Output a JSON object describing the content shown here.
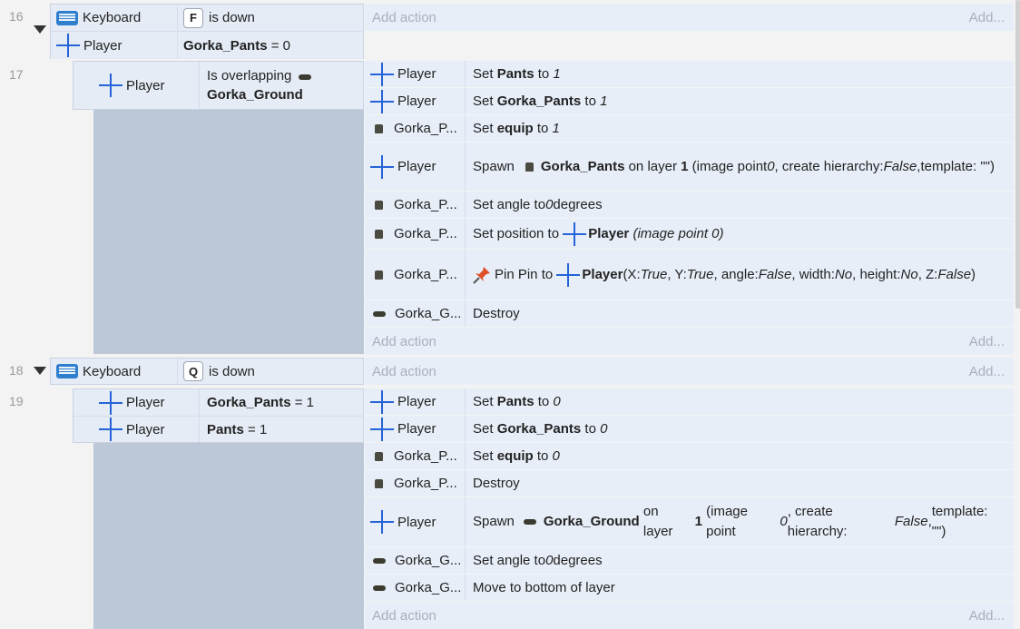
{
  "events": {
    "e16": {
      "num": "16",
      "cond1": {
        "obj": "Keyboard",
        "key": "F",
        "text": "is down"
      },
      "cond2": {
        "obj": "Player",
        "var": "Gorka_Pants",
        "op": "= 0"
      },
      "add_action": "Add action",
      "add": "Add..."
    },
    "e17": {
      "num": "17",
      "cond": {
        "obj": "Player",
        "text": "Is overlapping",
        "target": "Gorka_Ground"
      },
      "actions": [
        {
          "obj": "Player",
          "pre": "Set ",
          "b": "Pants",
          "post": " to ",
          "val": "1"
        },
        {
          "obj": "Player",
          "pre": "Set ",
          "b": "Gorka_Pants",
          "post": " to ",
          "val": "1"
        },
        {
          "obj": "Gorka_P...",
          "pre": "Set ",
          "b": "equip",
          "post": " to ",
          "val": "1"
        },
        {
          "obj": "Player",
          "spawn_pre": "Spawn",
          "spawn_obj": "Gorka_Pants",
          "spawn_mid": "on layer",
          "layer": "1",
          "paren1": "(image point ",
          "ip": "0",
          "paren2": ", create hierarchy: ",
          "ch": "False",
          "paren3": ",",
          "tmpl": "template: \"\")"
        },
        {
          "obj": "Gorka_P...",
          "pre": "Set angle to ",
          "val": "0",
          "post": " degrees"
        },
        {
          "obj": "Gorka_P...",
          "pre": "Set position to",
          "target": "Player",
          "ital": "(image point 0)"
        },
        {
          "obj": "Gorka_P...",
          "pin": "Pin Pin to",
          "target": "Player",
          "l1": " (X: ",
          "x": "True",
          "l2": ", Y: ",
          "y": "True",
          "l3": ", angle: ",
          "a": "False",
          "l4": ", width: ",
          "w": "No",
          "l5": ", height: ",
          "h": "No",
          "l6": ", Z:",
          "z": "False",
          "l7": ")"
        },
        {
          "obj": "Gorka_G...",
          "text": "Destroy"
        }
      ],
      "add_action": "Add action",
      "add": "Add..."
    },
    "e18": {
      "num": "18",
      "cond": {
        "obj": "Keyboard",
        "key": "Q",
        "text": "is down"
      },
      "add_action": "Add action",
      "add": "Add..."
    },
    "e19": {
      "num": "19",
      "cond1": {
        "obj": "Player",
        "var": "Gorka_Pants",
        "op": "= 1"
      },
      "cond2": {
        "obj": "Player",
        "var": "Pants",
        "op": "= 1"
      },
      "actions": [
        {
          "obj": "Player",
          "pre": "Set ",
          "b": "Pants",
          "post": " to ",
          "val": "0"
        },
        {
          "obj": "Player",
          "pre": "Set ",
          "b": "Gorka_Pants",
          "post": " to ",
          "val": "0"
        },
        {
          "obj": "Gorka_P...",
          "pre": "Set ",
          "b": "equip",
          "post": " to ",
          "val": "0"
        },
        {
          "obj": "Gorka_P...",
          "text": "Destroy"
        },
        {
          "obj": "Player",
          "spawn_pre": "Spawn",
          "spawn_obj": "Gorka_Ground",
          "spawn_mid": "on layer",
          "layer": "1",
          "paren1": "(image point ",
          "ip": "0",
          "paren2": ", create hierarchy: ",
          "ch": "False",
          "paren3": ",",
          "tmpl": "template: \"\")"
        },
        {
          "obj": "Gorka_G...",
          "pre": "Set angle to ",
          "val": "0",
          "post": " degrees"
        },
        {
          "obj": "Gorka_G...",
          "text": "Move to bottom of layer"
        }
      ],
      "add_action": "Add action",
      "add": "Add..."
    }
  },
  "colors": {
    "accent": "#2563d8",
    "row_bg": "#e8eef8",
    "indent_bg": "#bcc8d8",
    "pin": "#e0502a"
  },
  "icons": {
    "player": "cross-icon",
    "keyboard": "keyboard-icon",
    "pants": "pants-sprite-icon",
    "ground": "ground-sprite-icon",
    "pin": "pin-icon"
  }
}
